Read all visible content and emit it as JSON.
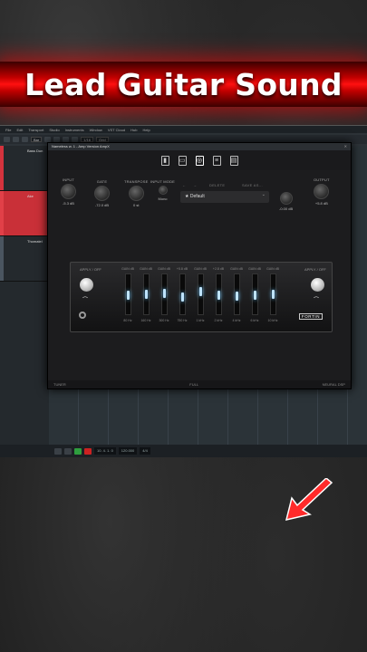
{
  "banner": {
    "title": "Lead Guitar Sound"
  },
  "daw": {
    "menu": [
      "File",
      "Edit",
      "Transport",
      "Studio",
      "Instruments",
      "Window",
      "VST Cloud",
      "Hub",
      "Help"
    ],
    "toolbar": {
      "grid_value": "Bar",
      "quantize_value": "1/16",
      "snap_value": "Grid",
      "tracks": [
        {
          "label": "Bass Dun",
          "color": "#d4333d"
        },
        {
          "label": "Ake",
          "color": "#d4333d"
        },
        {
          "label": "Thomatel",
          "color": "#4a5560"
        }
      ]
    },
    "transport": {
      "position": "10. 4. 1. 0",
      "tempo": "120.000",
      "time_sig": "4/4"
    }
  },
  "plugin": {
    "title": "Nameless w. 1 - Amp Version AmpX",
    "header_icons": [
      "amp-icon",
      "cabinet-icon",
      "pedal-icon",
      "eq-icon",
      "rack-icon"
    ],
    "controls": {
      "input": {
        "label": "INPUT",
        "value": "-5.3 dB"
      },
      "gate": {
        "label": "GATE",
        "value": "-72.0 dB"
      },
      "transpose": {
        "label": "TRANSPOSE",
        "value": "0 st"
      },
      "input_mode": {
        "label": "INPUT MODE",
        "value": "Mono"
      },
      "output": {
        "label": "OUTPUT",
        "value": "+5.8 dB"
      },
      "output_gain": {
        "value": "-0.00 dB"
      }
    },
    "preset": {
      "value": "Default",
      "delete": "DELETE",
      "save_as": "SAVE AS..."
    },
    "eq": {
      "in_label": "APPLY / OFF",
      "out_label": "APPLY / OFF",
      "brand": "FORTIN",
      "bands": [
        {
          "top": "GAIN dB",
          "freq": "80 Hz",
          "level": 0.5
        },
        {
          "top": "GAIN dB",
          "freq": "160 Hz",
          "level": 0.52
        },
        {
          "top": "GAIN dB",
          "freq": "300 Hz",
          "level": 0.55
        },
        {
          "top": "+5.8 dB",
          "freq": "750 Hz",
          "level": 0.45
        },
        {
          "top": "GAIN dB",
          "freq": "1 kHz",
          "level": 0.62
        },
        {
          "top": "+2.8 dB",
          "freq": "2 kHz",
          "level": 0.5
        },
        {
          "top": "GAIN dB",
          "freq": "4 kHz",
          "level": 0.48
        },
        {
          "top": "GAIN dB",
          "freq": "6 kHz",
          "level": 0.5
        },
        {
          "top": "GAIN dB",
          "freq": "10 kHz",
          "level": 0.52
        }
      ]
    },
    "footer": {
      "left": "TUNER",
      "mid": "FULL",
      "right": "NEURAL DSP"
    }
  }
}
